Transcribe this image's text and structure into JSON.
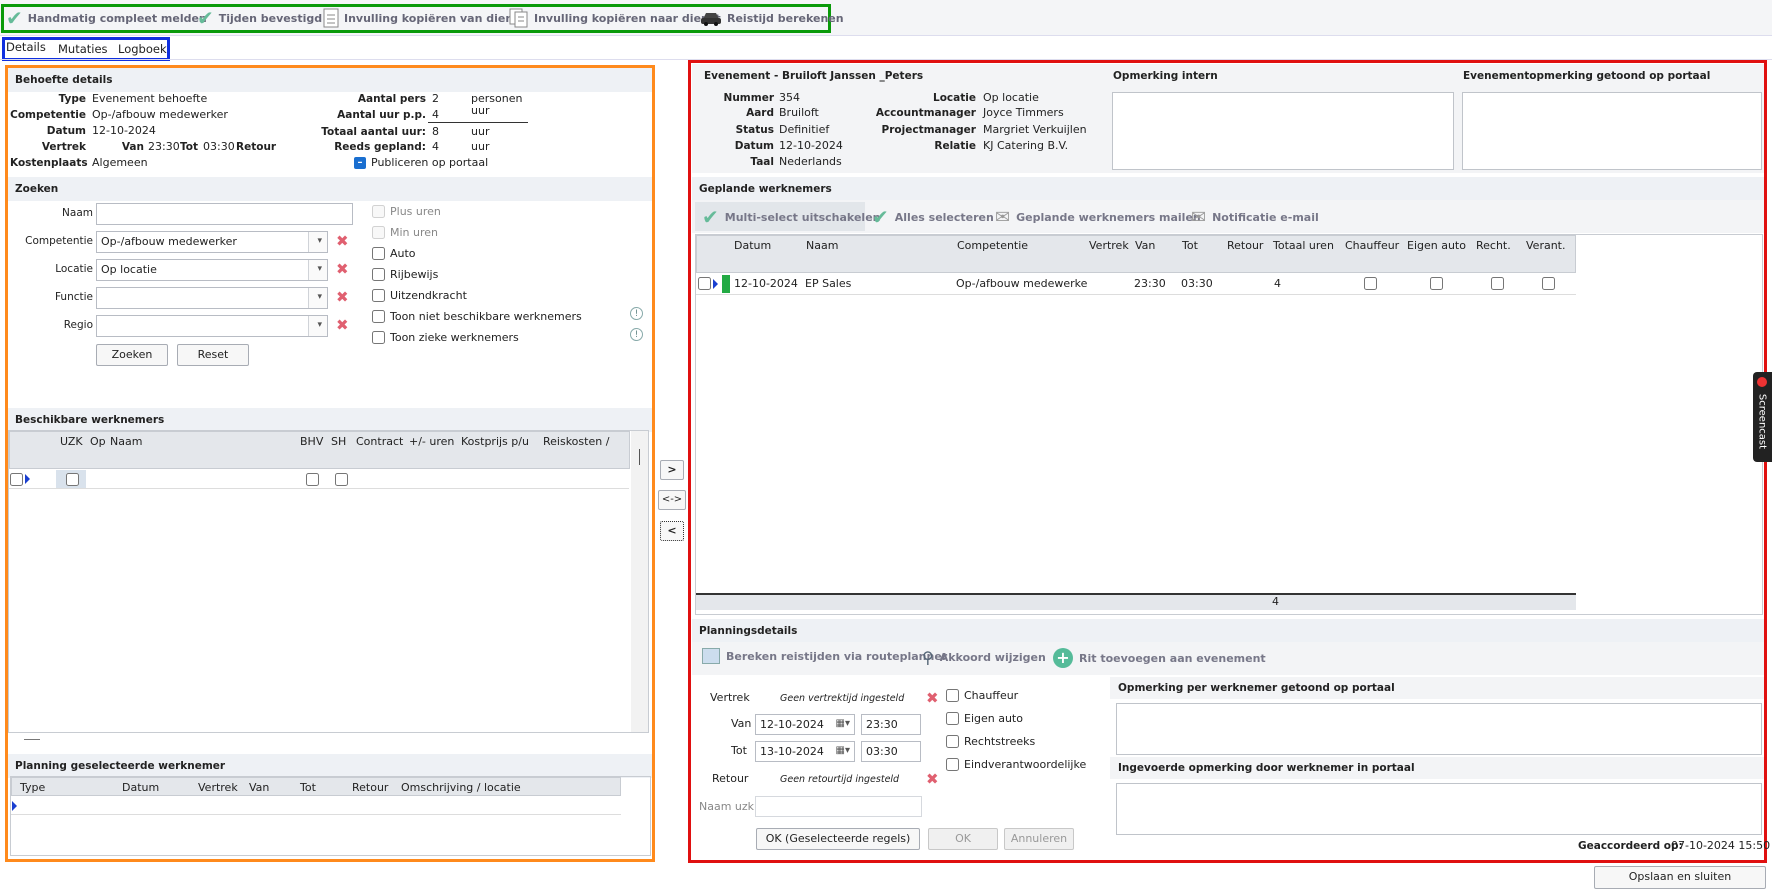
{
  "toolbar": {
    "items": [
      {
        "label": "Handmatig compleet melden"
      },
      {
        "label": "Tijden bevestigd"
      },
      {
        "label": "Invulling kopiëren van dienst"
      },
      {
        "label": "Invulling kopiëren naar dienst"
      },
      {
        "label": "Reistijd berekenen"
      }
    ]
  },
  "tabs": [
    "Details",
    "Mutaties",
    "Logboek"
  ],
  "need": {
    "header": "Behoefte details",
    "type_label": "Type",
    "type": "Evenement behoefte",
    "comp_label": "Competentie",
    "comp": "Op-/afbouw medewerker",
    "date_label": "Datum",
    "date": "12-10-2024",
    "vertrek_label": "Vertrek",
    "van_label": "Van",
    "van": "23:30",
    "tot_label": "Tot",
    "tot": "03:30",
    "retour_label": "Retour",
    "kp_label": "Kostenplaats",
    "kp": "Algemeen",
    "pers_label": "Aantal pers",
    "pers": "2",
    "pers_unit": "personen",
    "uur_label": "Aantal uur p.p.",
    "uur": "4",
    "uur_unit": "uur",
    "totaal_label": "Totaal aantal uur:",
    "totaal": "8",
    "totaal_unit": "uur",
    "gepland_label": "Reeds gepland:",
    "gepland": "4",
    "gepland_unit": "uur",
    "publish_label": "Publiceren op portaal"
  },
  "search": {
    "header": "Zoeken",
    "naam_label": "Naam",
    "naam": "",
    "comp_label": "Competentie",
    "comp": "Op-/afbouw medewerker",
    "locatie_label": "Locatie",
    "locatie": "Op locatie",
    "functie_label": "Functie",
    "functie": "",
    "regio_label": "Regio",
    "regio": "",
    "zoeken": "Zoeken",
    "reset": "Reset",
    "checks": [
      "Plus uren",
      "Min uren",
      "Auto",
      "Rijbewijs",
      "Uitzendkracht",
      "Toon niet beschikbare werknemers",
      "Toon zieke werknemers"
    ]
  },
  "available": {
    "header": "Beschikbare werknemers",
    "columns": [
      "UZK",
      "Op",
      "Naam",
      "BHV",
      "SH",
      "Contract",
      "+/- uren",
      "Kostprijs p/u",
      "Reiskosten /"
    ]
  },
  "planning_sel": {
    "header": "Planning geselecteerde werknemer",
    "columns": [
      "Type",
      "Datum",
      "Vertrek",
      "Van",
      "Tot",
      "Retour",
      "Omschrijving / locatie"
    ]
  },
  "transfer": [
    ">",
    "<->",
    "<"
  ],
  "event": {
    "title": "Evenement - Bruiloft Janssen _Peters",
    "nummer_label": "Nummer",
    "nummer": "354",
    "aard_label": "Aard",
    "aard": "Bruiloft",
    "status_label": "Status",
    "status": "Definitief",
    "datum_label": "Datum",
    "datum": "12-10-2024",
    "taal_label": "Taal",
    "taal": "Nederlands",
    "locatie_label": "Locatie",
    "locatie": "Op locatie",
    "am_label": "Accountmanager",
    "am": "Joyce Timmers",
    "pm_label": "Projectmanager",
    "pm": "Margriet Verkuijlen",
    "relatie_label": "Relatie",
    "relatie": "KJ Catering B.V.",
    "opm_intern": "Opmerking intern",
    "opm_portaal": "Evenementopmerking getoond op portaal"
  },
  "planned": {
    "header": "Geplande werknemers",
    "tools": [
      "Multi-select uitschakelen",
      "Alles selecteren",
      "Geplande werknemers mailen",
      "Notificatie e-mail"
    ],
    "columns": [
      "Datum",
      "Naam",
      "Competentie",
      "Vertrek",
      "Van",
      "Tot",
      "Retour",
      "Totaal uren",
      "Chauffeur",
      "Eigen auto",
      "Recht.",
      "Verant."
    ],
    "rows": [
      {
        "datum": "12-10-2024",
        "naam": "EP Sales",
        "comp": "Op-/afbouw medewerke",
        "van": "23:30",
        "tot": "03:30",
        "totaal": "4"
      }
    ],
    "footer_total": "4"
  },
  "planning_details": {
    "header": "Planningsdetails",
    "tools": [
      "Bereken reistijden via routeplanner",
      "Akkoord wijzigen",
      "Rit toevoegen aan evenement"
    ],
    "vertrek_label": "Vertrek",
    "vertrek_none": "Geen vertrektijd ingesteld",
    "van_label": "Van",
    "van_date": "12-10-2024",
    "van_time": "23:30",
    "tot_label": "Tot",
    "tot_date": "13-10-2024",
    "tot_time": "03:30",
    "retour_label": "Retour",
    "retour_none": "Geen retourtijd ingesteld",
    "uzk_label": "Naam uzk",
    "checks": [
      "Chauffeur",
      "Eigen auto",
      "Rechtstreeks",
      "Eindverantwoordelijke"
    ],
    "opm_portaal": "Opmerking per werknemer getoond op portaal",
    "opm_werknemer": "Ingevoerde opmerking door werknemer in portaal",
    "btn_ok_sel": "OK (Geselecteerde regels)",
    "btn_ok": "OK",
    "btn_cancel": "Annuleren",
    "geaccordeerd_label": "Geaccordeerd op:",
    "geaccordeerd": "07-10-2024 15:50"
  },
  "save_close": "Opslaan en sluiten",
  "side_tab": "Screencast",
  "colors": {
    "green_box": "#0a9a0a",
    "blue_box": "#1030e0",
    "orange_box": "#ff8a1c",
    "red_box": "#e01010",
    "status_green": "#22aa44"
  }
}
